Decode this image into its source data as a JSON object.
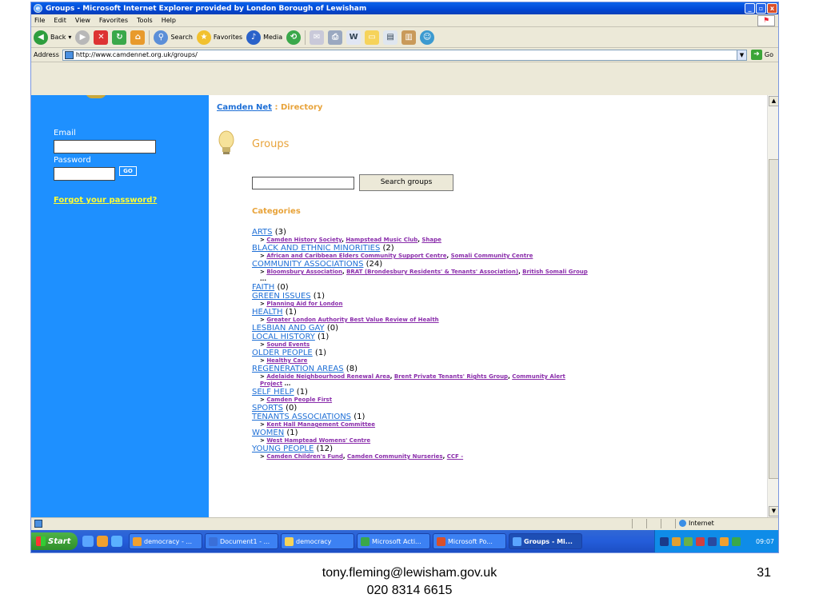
{
  "window": {
    "title": "Groups - Microsoft Internet Explorer provided by London Borough of Lewisham",
    "controls": [
      "_",
      "▫",
      "x"
    ]
  },
  "menu": [
    "File",
    "Edit",
    "View",
    "Favorites",
    "Tools",
    "Help"
  ],
  "toolbar": {
    "back": "Back",
    "search": "Search",
    "favorites": "Favorites",
    "media": "Media"
  },
  "address": {
    "label": "Address",
    "url": "http://www.camdennet.org.uk/groups/",
    "go": "Go"
  },
  "login": {
    "email_label": "Email",
    "password_label": "Password",
    "go": "GO",
    "forgot": "Forgot your password?"
  },
  "page": {
    "breadcrumb_link": "Camden Net",
    "breadcrumb_rest": " : Directory",
    "title": "Groups",
    "search_button": "Search groups",
    "categories_heading": "Categories"
  },
  "categories": [
    {
      "name": "ARTS",
      "count": " (3)",
      "sub": [
        "Camden History Society",
        "Hampstead Music Club",
        "Shape"
      ],
      "more": false
    },
    {
      "name": "BLACK AND ETHNIC MINORITIES",
      "count": " (2)",
      "sub": [
        "African and Caribbean Elders Community Support Centre",
        "Somali Community Centre"
      ],
      "more": false
    },
    {
      "name": "COMMUNITY ASSOCIATIONS",
      "count": " (24)",
      "sub": [
        "Bloomsbury Association",
        "BRAT (Brondesbury Residents' & Tenants' Association)",
        "British Somali Group"
      ],
      "more": true
    },
    {
      "name": "FAITH",
      "count": " (0)",
      "sub": [],
      "more": false
    },
    {
      "name": "GREEN ISSUES",
      "count": " (1)",
      "sub": [
        "Planning Aid for London"
      ],
      "more": false
    },
    {
      "name": "HEALTH",
      "count": " (1)",
      "sub": [
        "Greater London Authority Best Value Review of Health"
      ],
      "more": false
    },
    {
      "name": "LESBIAN AND GAY",
      "count": " (0)",
      "sub": [],
      "more": false
    },
    {
      "name": "LOCAL HISTORY",
      "count": " (1)",
      "sub": [
        "Sound Events"
      ],
      "more": false
    },
    {
      "name": "OLDER PEOPLE",
      "count": " (1)",
      "sub": [
        "Healthy Care"
      ],
      "more": false
    },
    {
      "name": "REGENERATION AREAS",
      "count": " (8)",
      "sub": [
        "Adelaide Neighbourhood Renewal Area",
        "Brent Private Tenants' Rights Group",
        "Community Alert Project"
      ],
      "more": true
    },
    {
      "name": "SELF HELP",
      "count": " (1)",
      "sub": [
        "Camden People First"
      ],
      "more": false
    },
    {
      "name": "SPORTS",
      "count": " (0)",
      "sub": [],
      "more": false
    },
    {
      "name": "TENANTS ASSOCIATIONS",
      "count": " (1)",
      "sub": [
        "Kent Hall Management Committee"
      ],
      "more": false
    },
    {
      "name": "WOMEN",
      "count": " (1)",
      "sub": [
        "West Hamptead Womens' Centre"
      ],
      "more": false
    },
    {
      "name": "YOUNG PEOPLE",
      "count": " (12)",
      "sub": [
        "Camden Children's Fund",
        "Camden Community Nurseries",
        "CCF -"
      ],
      "more": false
    }
  ],
  "status": {
    "zone": "Internet"
  },
  "taskbar": {
    "start": "Start",
    "tasks": [
      {
        "label": "democracy - ...",
        "color": "#f0a030"
      },
      {
        "label": "Document1 - ...",
        "color": "#3a6fd8"
      },
      {
        "label": "democracy",
        "color": "#f6d35a"
      },
      {
        "label": "Microsoft Acti...",
        "color": "#3aa84a"
      },
      {
        "label": "Microsoft Po...",
        "color": "#d9502b"
      },
      {
        "label": "Groups - Mi...",
        "color": "#5aa5ff"
      }
    ],
    "clock": "09:07"
  },
  "footer": {
    "email": "tony.fleming@lewisham.gov.uk",
    "phone": "020 8314 6615",
    "page_number": "31"
  }
}
